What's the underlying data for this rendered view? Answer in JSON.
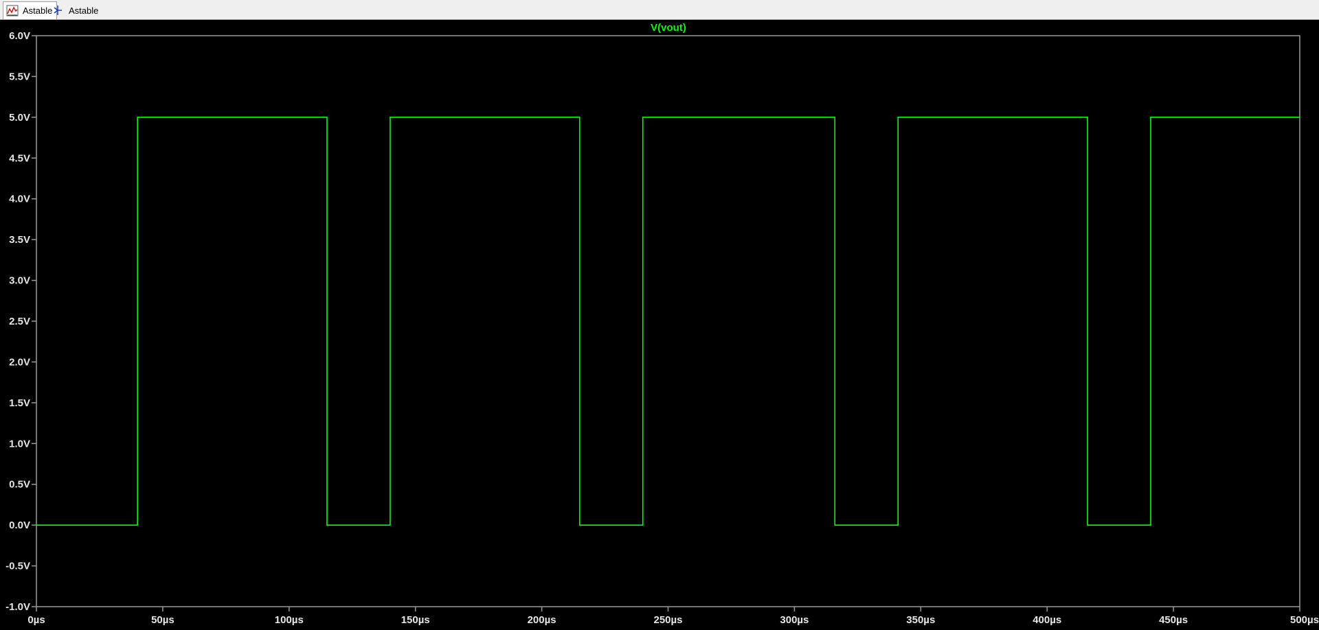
{
  "tabs": [
    {
      "label": "Astable",
      "icon": "waveform-plot-icon",
      "active": true
    },
    {
      "label": "Astable",
      "icon": "schematic-icon",
      "active": false
    }
  ],
  "colors": {
    "background": "#000000",
    "axis": "#9a9a9a",
    "trace": "#00ff00",
    "tick_text": "#e6e6e6"
  },
  "chart_data": {
    "type": "line",
    "title": "V(vout)",
    "xlabel": "",
    "ylabel": "",
    "xlim": [
      0,
      500
    ],
    "ylim": [
      -1.0,
      6.0
    ],
    "x_unit": "µs",
    "y_unit": "V",
    "grid": false,
    "x_ticks": [
      "0µs",
      "50µs",
      "100µs",
      "150µs",
      "200µs",
      "250µs",
      "300µs",
      "350µs",
      "400µs",
      "450µs",
      "500µs"
    ],
    "y_ticks": [
      "6.0V",
      "5.5V",
      "5.0V",
      "4.5V",
      "4.0V",
      "3.5V",
      "3.0V",
      "2.5V",
      "2.0V",
      "1.5V",
      "1.0V",
      "0.5V",
      "0.0V",
      "-0.5V",
      "-1.0V"
    ],
    "series": [
      {
        "name": "V(vout)",
        "x": [
          0,
          40,
          40,
          115,
          115,
          140,
          140,
          215,
          215,
          240,
          240,
          316,
          316,
          341,
          341,
          416,
          416,
          441,
          441,
          500
        ],
        "y": [
          0,
          0,
          5,
          5,
          0,
          0,
          5,
          5,
          0,
          0,
          5,
          5,
          0,
          0,
          5,
          5,
          0,
          0,
          5,
          5
        ]
      }
    ]
  }
}
